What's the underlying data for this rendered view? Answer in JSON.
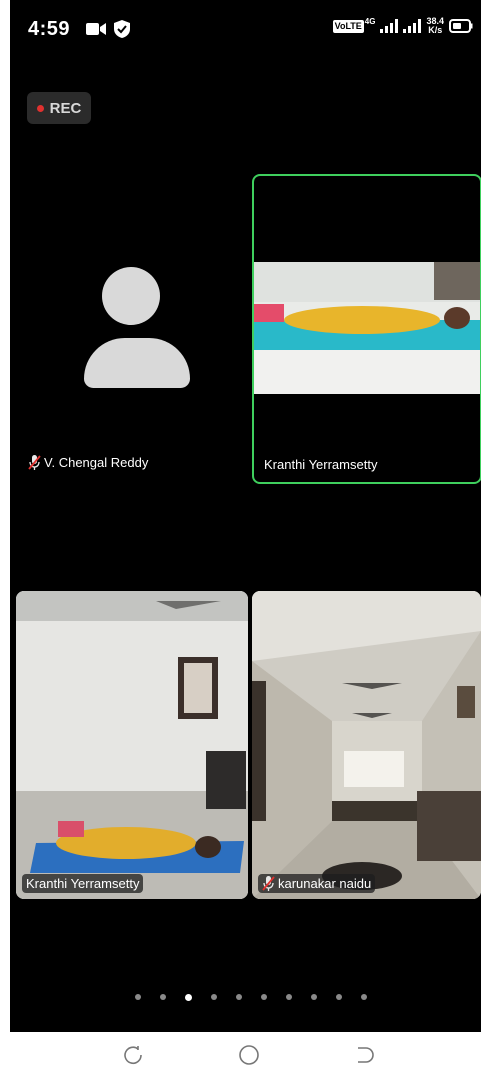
{
  "status_bar": {
    "time": "4:59",
    "network_badge": "VoLTE",
    "network_gen": "4G",
    "speed_value": "38.4",
    "speed_unit": "K/s",
    "icons": [
      "video-camera-icon",
      "shield-check-icon",
      "signal-icon",
      "signal-icon",
      "battery-icon"
    ]
  },
  "recording": {
    "label": "REC",
    "dot_color": "#e0312f"
  },
  "participants": [
    {
      "name": "V. Chengal Reddy",
      "muted": true,
      "video": false
    },
    {
      "name": "Kranthi Yerramsetty",
      "muted": false,
      "video": true,
      "active_speaker": true
    },
    {
      "name": "Kranthi Yerramsetty",
      "muted": false,
      "video": true
    },
    {
      "name": "karunakar naidu",
      "muted": true,
      "video": true
    }
  ],
  "pagination": {
    "total": 10,
    "active_index": 2
  },
  "nav_bar": {
    "icons": [
      "recents-icon",
      "home-icon",
      "back-icon"
    ]
  },
  "colors": {
    "active_speaker_border": "#3fcf5d",
    "muted_mic": "#e0312f",
    "screen_bg": "#000000"
  }
}
